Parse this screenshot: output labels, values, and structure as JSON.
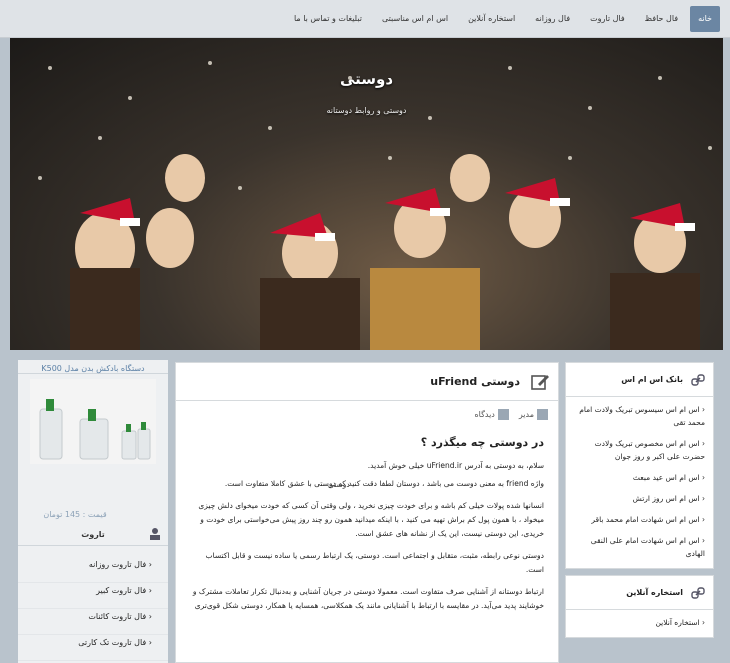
{
  "nav": {
    "items": [
      "خانه",
      "فال حافظ",
      "فال تاروت",
      "فال روزانه",
      "استخاره آنلاین",
      "اس ام اس مناسبتی",
      "تبلیغات و تماس با ما"
    ]
  },
  "hero": {
    "title": "دوستی",
    "subtitle": "دوستی و روابط دوستانه"
  },
  "product": {
    "title": "دستگاه بادکش بدن مدل K500",
    "price": "قیمت : 145 تومان"
  },
  "left": {
    "heading": "تاروت",
    "items": [
      "فال تاروت روزانه",
      "فال تاروت کبیر",
      "فال تاروت کائنات",
      "فال تاروت تک کارتی"
    ]
  },
  "main": {
    "title": "دوستی uFriend",
    "author": "مدیر",
    "comments": "دیدگاه",
    "question": "در دوستی چه میگذرد ؟",
    "tag": "دوستی",
    "p1": "سلام، به دوستی به آدرس uFriend.ir خیلی خوش آمدید.",
    "p2": "واژه friend به معنی دوست می باشد ، دوستان لطفا دقت کنید که دوستی با عشق کاملا متفاوت است.",
    "p3": "انسانها شده پولات خیلی کم باشه و برای خودت چیزی نخرید ، ولی وقتی آن کسی که خودت میخوای دلش چیزی میخواد ، با همون پول کم براش تهیه می کنید ، با اینکه میدانید همون رو چند روز پیش می‌خواستی برای خودت و خریدی، این دوستی نیست، این یک از نشانه های عشق است.",
    "p4": "دوستی نوعی رابطه، مثبت، متقابل و اجتماعی است. دوستی، یک ارتباط رسمی یا ساده نیست و قابل اکتساب است.",
    "p5": "ارتباط دوستانه از آشنایی صرف متفاوت است. معمولا دوستی در جریان آشنایی و به‌دنبال تکرار تعاملات مشترک و خوشایند پدید می‌آید. در مقایسه با ارتباط با آشنایانی مانند یک همکلاسی، همسایه یا همکار، دوستی شکل قوی‌تری"
  },
  "sms": {
    "heading": "بانک اس ام اس",
    "items": [
      "اس ام اس سیسوس تبریک ولادت امام محمد تقی",
      "اس ام اس مخصوص تبریک ولادت حضرت علی اکبر و روز جوان",
      "اس ام اس عید مبعث",
      "اس ام اس روز ارتش",
      "اس ام اس شهادت امام محمد باقر",
      "اس ام اس شهادت امام علی النقی الهادی"
    ]
  },
  "istikhara": {
    "heading": "استخاره آنلاین",
    "items": [
      "استخاره آنلاین"
    ]
  }
}
